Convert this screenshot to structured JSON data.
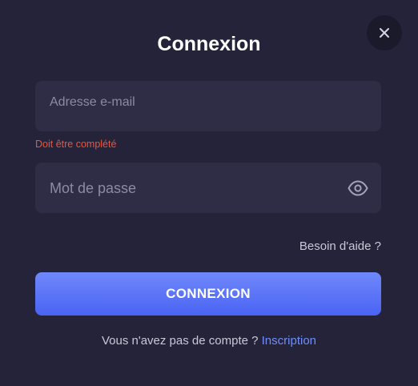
{
  "modal": {
    "title": "Connexion",
    "close_icon": "close-icon"
  },
  "email_field": {
    "placeholder": "Adresse e-mail",
    "value": "",
    "error": "Doit être complété"
  },
  "password_field": {
    "placeholder": "Mot de passe",
    "value": "",
    "toggle_icon": "eye-icon"
  },
  "help_link": "Besoin d'aide ?",
  "submit_label": "CONNEXION",
  "signup": {
    "prompt": "Vous n'avez pas de compte ?",
    "link": "Inscription"
  },
  "colors": {
    "background": "#24233a",
    "field_background": "#2e2d45",
    "error": "#e8563f",
    "accent": "#5b75f7",
    "link": "#6f8ef8"
  }
}
